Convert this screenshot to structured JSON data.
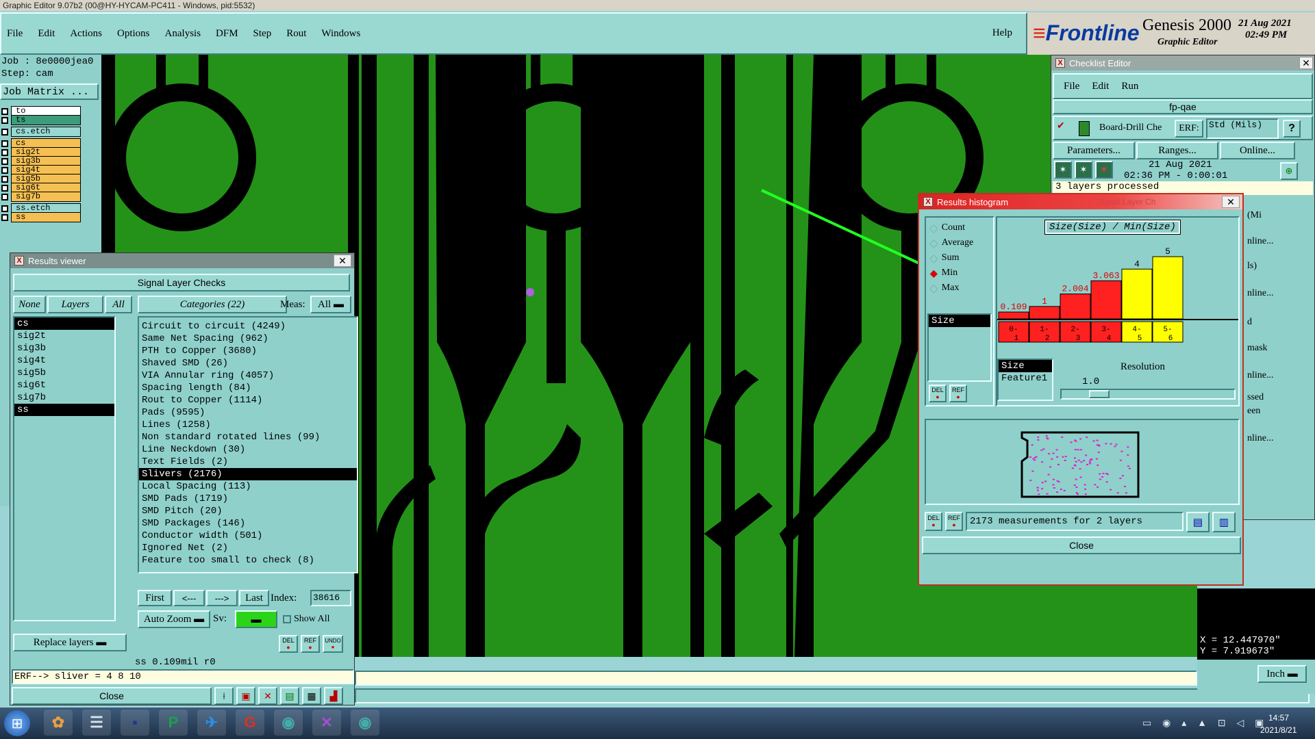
{
  "app": {
    "title": "Graphic Editor 9.07b2 (00@HY-HYCAM-PC411 - Windows, pid:5532)",
    "menu": [
      "File",
      "Edit",
      "Actions",
      "Options",
      "Analysis",
      "DFM",
      "Step",
      "Rout",
      "Windows"
    ],
    "help": "Help",
    "logo": "Frontline",
    "product": "Genesis 2000",
    "product_sub": "Graphic Editor",
    "date": "21 Aug 2021",
    "time": "02:49 PM"
  },
  "job": {
    "job_label": "Job : 8e0000jea0",
    "step_label": "Step: cam",
    "matrix_button": "Job Matrix ...",
    "layers": [
      {
        "name": "to",
        "color": "#ffffff"
      },
      {
        "name": "ts",
        "color": "#3c9c7c"
      },
      {
        "name": "cs.etch",
        "color": "#9ad8d2"
      },
      {
        "name": "cs",
        "color": "#f5c053"
      },
      {
        "name": "sig2t",
        "color": "#f5c053"
      },
      {
        "name": "sig3b",
        "color": "#f5c053"
      },
      {
        "name": "sig4t",
        "color": "#f5c053"
      },
      {
        "name": "sig5b",
        "color": "#f5c053"
      },
      {
        "name": "sig6t",
        "color": "#f5c053"
      },
      {
        "name": "sig7b",
        "color": "#f5c053"
      },
      {
        "name": "ss.etch",
        "color": "#9ad8d2"
      },
      {
        "name": "ss",
        "color": "#f5c053"
      }
    ]
  },
  "results_viewer": {
    "title": "Results viewer",
    "header": "Signal Layer Checks",
    "none_btn": "None",
    "layers_btn": "Layers",
    "all_btn": "All",
    "categories_btn": "Categories (22)",
    "meas_label": "Meas:",
    "meas_value": "All",
    "layers": [
      "cs",
      "sig2t",
      "sig3b",
      "sig4t",
      "sig5b",
      "sig6t",
      "sig7b",
      "ss"
    ],
    "selected_layers": [
      "cs",
      "ss"
    ],
    "categories": [
      "Circuit to circuit (4249)",
      "Same Net Spacing (962)",
      "PTH to Copper (3680)",
      "Shaved SMD (26)",
      "VIA Annular ring (4057)",
      "Spacing length (84)",
      "Rout to Copper (1114)",
      "Pads (9595)",
      "Lines (1258)",
      "Non standard rotated lines (99)",
      "Line Neckdown (30)",
      "Text Fields (2)",
      "Slivers (2176)",
      "Local Spacing (113)",
      "SMD Pads (1719)",
      "SMD Pitch (20)",
      "SMD Packages (146)",
      "Conductor width (501)",
      "Ignored Net (2)",
      "Feature too small to check (8)"
    ],
    "selected_category": "Slivers (2176)",
    "first_btn": "First",
    "prev_btn": "<---",
    "next_btn": "--->",
    "last_btn": "Last",
    "index_label": "Index:",
    "index_value": "38616",
    "auto_zoom": "Auto Zoom",
    "sv_label": "Sv:",
    "show_all": "Show All",
    "replace_layers": "Replace layers",
    "status_line": "ss 0.109mil  r0",
    "erf_line": "ERF--> sliver = 4 8 10",
    "close_btn": "Close",
    "del": "DEL",
    "ref": "REF",
    "undo": "UNDO"
  },
  "checklist": {
    "title": "Checklist Editor",
    "menu": [
      "File",
      "Edit",
      "Run"
    ],
    "name": "fp-qae",
    "action": "Board-Drill Che",
    "erf_label": "ERF:",
    "erf_value": "Std (Mils)",
    "parameters": "Parameters...",
    "ranges": "Ranges...",
    "online": "Online...",
    "run_date": "21 Aug 2021",
    "run_time": "02:36 PM - 0:00:01",
    "status": "3 layers processed",
    "right_fragments": [
      "(Mi",
      "nline...",
      "ls)",
      "nline...",
      "d",
      "mask",
      "nline...",
      "ssed",
      "een",
      "nline..."
    ]
  },
  "histogram": {
    "title": "Results histogram",
    "behind_title": "Signal Layer Ch",
    "options": [
      "Count",
      "Average",
      "Sum",
      "Min",
      "Max"
    ],
    "selected_option": "Min",
    "list_items": [
      "Size"
    ],
    "graph_title": "Size(Size) / Min(Size)",
    "resolution_label": "Resolution",
    "resolution_value": "1.0",
    "fields": [
      "Size",
      "Feature1"
    ],
    "measurement_text": "2173 measurements for 2 layers",
    "close_btn": "Close",
    "del": "DEL",
    "ref": "REF"
  },
  "chart_data": {
    "type": "bar",
    "title": "Size(Size) / Min(Size)",
    "categories": [
      "0-1",
      "1-2",
      "2-3",
      "3-4",
      "4-5",
      "5-6"
    ],
    "values": [
      0.109,
      1,
      2.004,
      3.063,
      4,
      5
    ],
    "labels": [
      "0.109",
      "1",
      "2.004",
      "3.063",
      "4",
      "5"
    ],
    "colors": [
      "#ff2020",
      "#ff2020",
      "#ff2020",
      "#ff2020",
      "#ffff00",
      "#ffff00"
    ],
    "ylim": [
      0,
      5.5
    ]
  },
  "coords": {
    "x": "X = 12.447970\"",
    "y": "Y = 7.919673\""
  },
  "units": "Inch",
  "taskbar": {
    "time": "14:57",
    "date": "2021/8/21"
  }
}
